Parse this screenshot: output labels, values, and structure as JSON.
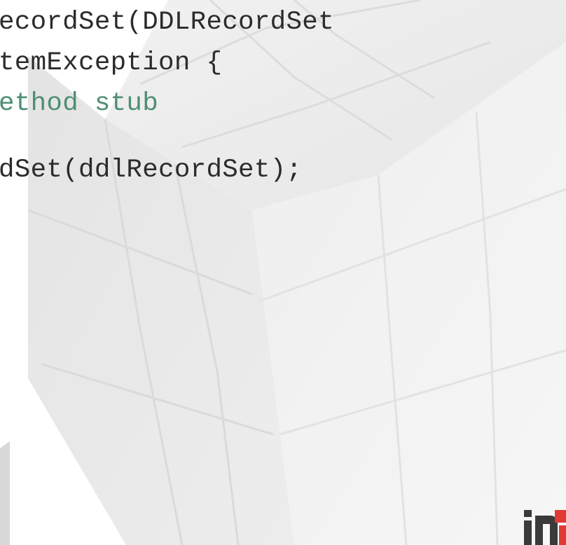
{
  "code": {
    "lines": [
      {
        "text": "ecordSet(DDLRecordSet",
        "kind": "code"
      },
      {
        "text": "temException {",
        "kind": "code"
      },
      {
        "text": "ethod stub",
        "kind": "comment"
      },
      {
        "text": "",
        "kind": "blank"
      },
      {
        "text": "dSet(ddlRecordSet);",
        "kind": "code"
      }
    ],
    "colors": {
      "text": "#2b2b2b",
      "comment": "#4e8f72"
    }
  },
  "background": {
    "image": "rubiks-cube-watermark",
    "cube_color": "#e6e6e6"
  },
  "logo": {
    "icon": "ina-logo-icon",
    "colors": {
      "dark": "#3a3a3a",
      "red": "#e03a32"
    }
  }
}
